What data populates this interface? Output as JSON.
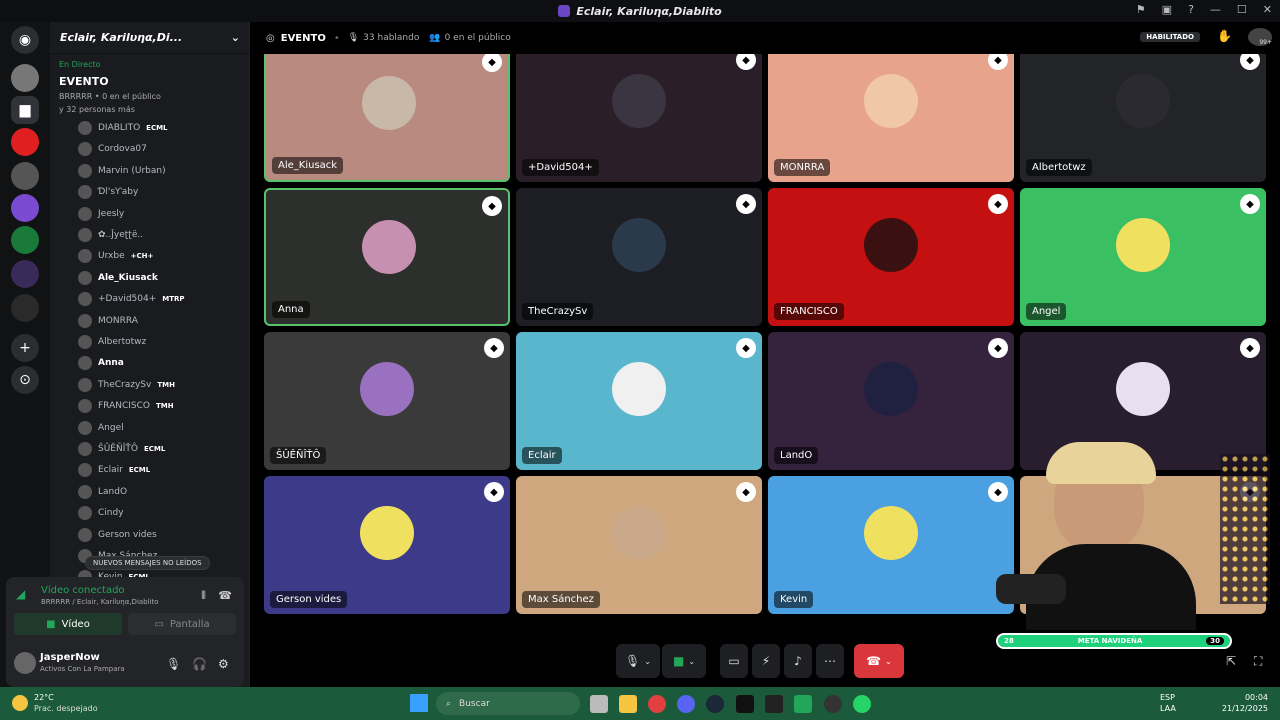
{
  "window": {
    "title": "Eclair, Karilυηα,Diablito"
  },
  "server": {
    "name": "Eclair, Karilυηα,Di..."
  },
  "live": {
    "status": "En Directo",
    "event": "EVENTO",
    "host_line": "BRRRRR • 0 en el público",
    "audience": "y 32 personas más"
  },
  "user_list": [
    {
      "name": "DIABLITO",
      "tag": "ECML",
      "bold": false
    },
    {
      "name": "Cordova07",
      "tag": "",
      "bold": false
    },
    {
      "name": "Marvin (Urban)",
      "tag": "",
      "bold": false
    },
    {
      "name": "Ɗl'sƳaby",
      "tag": "",
      "bold": false
    },
    {
      "name": "Jeesly",
      "tag": "",
      "bold": false
    },
    {
      "name": "✿..Ĵyeʈʈë..",
      "tag": "",
      "bold": false
    },
    {
      "name": "Urxbe",
      "tag": "+CH+",
      "bold": false
    },
    {
      "name": "Ale_Kiusack",
      "tag": "",
      "bold": true
    },
    {
      "name": "+David504+",
      "tag": "MTRP",
      "bold": false
    },
    {
      "name": "MONRRA",
      "tag": "",
      "bold": false
    },
    {
      "name": "Albertotwz",
      "tag": "",
      "bold": false
    },
    {
      "name": "Anna",
      "tag": "",
      "bold": true
    },
    {
      "name": "TheCrazySv",
      "tag": "TMH",
      "bold": false
    },
    {
      "name": "FRANCISCO",
      "tag": "TMH",
      "bold": false
    },
    {
      "name": "Angel",
      "tag": "",
      "bold": false
    },
    {
      "name": "ŜÛÊÑÎŤÔ",
      "tag": "ECML",
      "bold": false
    },
    {
      "name": "Eclair",
      "tag": "ECML",
      "bold": false
    },
    {
      "name": "LandO",
      "tag": "",
      "bold": false
    },
    {
      "name": "Cindy",
      "tag": "",
      "bold": false
    },
    {
      "name": "Gerson vides",
      "tag": "",
      "bold": false
    },
    {
      "name": "Max Sánchez",
      "tag": "",
      "bold": false
    },
    {
      "name": "Kevin",
      "tag": "ECML",
      "bold": false
    }
  ],
  "new_messages": "NUEVOS MENSAJES NO LEÍDOS",
  "voice": {
    "status": "Vídeo conectado",
    "channel": "BRRRRR / Eclair, Karilυηα,Diablito",
    "video_btn": "Vídeo",
    "screen_btn": "Pantalla"
  },
  "user": {
    "name": "JasperNow",
    "status": "Activos Con La Pampara"
  },
  "topbar": {
    "event": "EVENTO",
    "speaking": "33 hablando",
    "audience": "0 en el público",
    "badge": "HABILITADO",
    "notif": "99+"
  },
  "tiles": [
    {
      "name": "Ale_Kiusack",
      "bg": "#b88a80",
      "border": "#5ac26a"
    },
    {
      "name": "+David504+",
      "bg": "#2a1f28",
      "border": ""
    },
    {
      "name": "MONRRA",
      "bg": "#e8a38d",
      "border": ""
    },
    {
      "name": "Albertotwz",
      "bg": "#232428",
      "border": ""
    },
    {
      "name": "Anna",
      "bg": "#2d2f2c",
      "border": "#5ac26a"
    },
    {
      "name": "TheCrazySv",
      "bg": "#1c1e24",
      "border": ""
    },
    {
      "name": "FRANCISCO",
      "bg": "#c41010",
      "border": ""
    },
    {
      "name": "Angel",
      "bg": "#3ac063",
      "border": ""
    },
    {
      "name": "ŜÛÊÑÎŤÔ",
      "bg": "#3a3a3a",
      "border": ""
    },
    {
      "name": "Eclair",
      "bg": "#5ab6cc",
      "border": ""
    },
    {
      "name": "LandO",
      "bg": "#35233e",
      "border": ""
    },
    {
      "name": "",
      "bg": "#281e2e",
      "border": ""
    },
    {
      "name": "Gerson vides",
      "bg": "#3e3a8a",
      "border": ""
    },
    {
      "name": "Max Sánchez",
      "bg": "#cfa77f",
      "border": ""
    },
    {
      "name": "Kevin",
      "bg": "#4aa0e0",
      "border": ""
    },
    {
      "name": "",
      "bg": "#cfa77f",
      "border": ""
    }
  ],
  "meta": {
    "left": "28",
    "label": "META NAVIDEÑA",
    "right": "30"
  },
  "taskbar": {
    "temp": "22°C",
    "weather": "Prac. despejado",
    "search": "Buscar",
    "lang": "ESP",
    "lang2": "LAA",
    "time": "00:04",
    "date": "21/12/2025"
  }
}
